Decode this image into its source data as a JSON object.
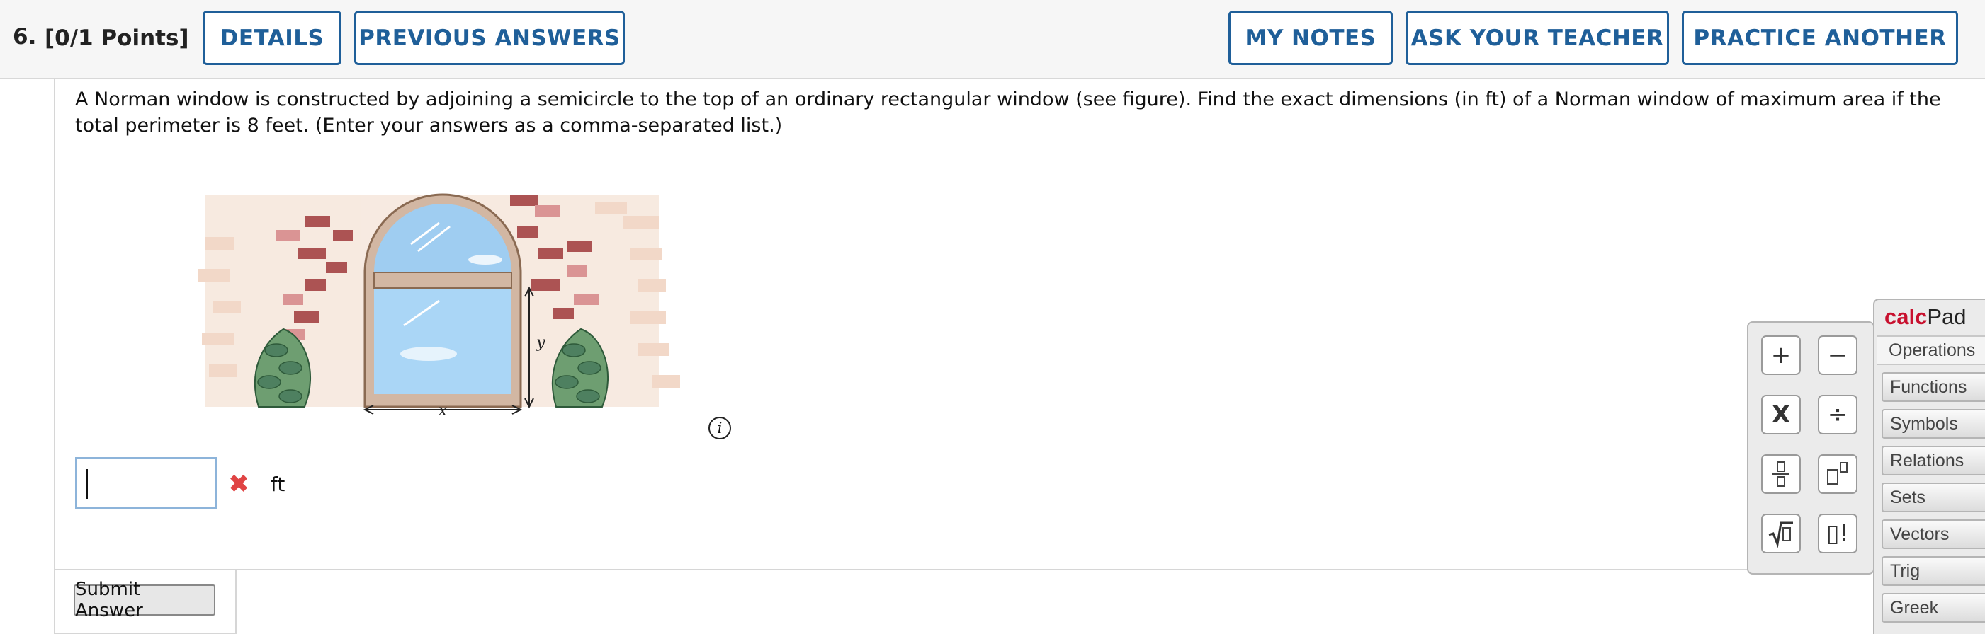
{
  "header": {
    "question_number": "6.",
    "points": "[0/1 Points]",
    "buttons": {
      "details": "DETAILS",
      "previous_answers": "PREVIOUS ANSWERS",
      "my_notes": "MY NOTES",
      "ask_teacher": "ASK YOUR TEACHER",
      "practice_another": "PRACTICE ANOTHER"
    }
  },
  "question": {
    "prompt": "A Norman window is constructed by adjoining a semicircle to the top of an ordinary rectangular window (see figure). Find the exact dimensions (in ft) of a Norman window of maximum area if the total perimeter is 8 feet. (Enter your answers as a comma-separated list.)",
    "figure_labels": {
      "width_label": "x",
      "height_label": "y"
    },
    "info_icon": "i"
  },
  "answer": {
    "value": "",
    "status": "incorrect",
    "status_mark": "✖",
    "unit": "ft"
  },
  "submit": {
    "label": "Submit Answer"
  },
  "calcpad": {
    "title_calc": "calc",
    "title_pad": "Pad",
    "active_tab": "Operations",
    "tabs": [
      "Functions",
      "Symbols",
      "Relations",
      "Sets",
      "Vectors",
      "Trig",
      "Greek"
    ],
    "keys": {
      "plus": "+",
      "minus": "−",
      "times": "X",
      "divide": "÷",
      "factorial": "▯!"
    }
  },
  "colors": {
    "accent": "#1f5f99",
    "error": "#e04444",
    "calc_brand": "#c8102e"
  }
}
